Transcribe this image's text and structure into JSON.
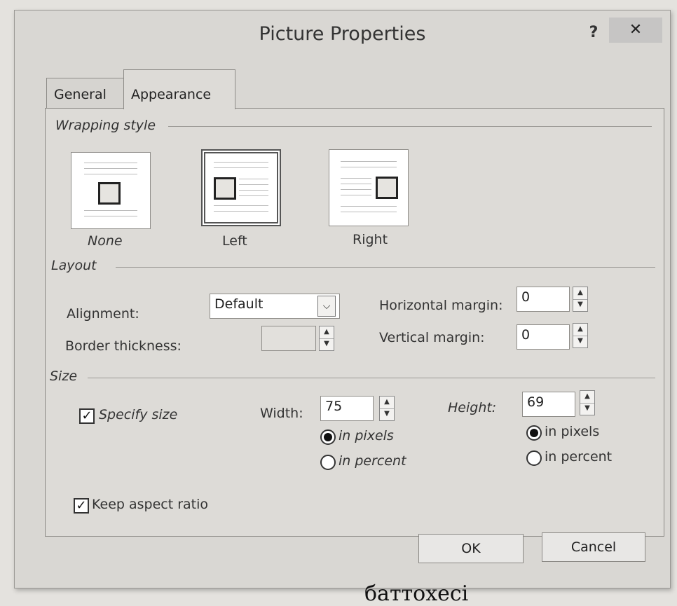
{
  "dialog": {
    "title": "Picture Properties",
    "help_label": "?",
    "close_label": "✕"
  },
  "tabs": [
    {
      "label": "General",
      "active": false
    },
    {
      "label": "Appearance",
      "active": true
    }
  ],
  "wrapping": {
    "group_label": "Wrapping style",
    "options": [
      {
        "label": "None",
        "selected": false
      },
      {
        "label": "Left",
        "selected": true
      },
      {
        "label": "Right",
        "selected": false
      }
    ]
  },
  "layout": {
    "group_label": "Layout",
    "alignment_label": "Alignment:",
    "alignment_value": "Default",
    "border_label": "Border thickness:",
    "border_value": "",
    "hmargin_label": "Horizontal margin:",
    "hmargin_value": "0",
    "vmargin_label": "Vertical margin:",
    "vmargin_value": "0"
  },
  "size": {
    "group_label": "Size",
    "specify_label": "Specify size",
    "specify_checked": true,
    "width_label": "Width:",
    "width_value": "75",
    "height_label": "Height:",
    "height_value": "69",
    "in_pixels": "in pixels",
    "in_percent": "in percent",
    "width_unit": "pixels",
    "height_unit": "pixels",
    "keep_aspect_label": "Keep aspect ratio",
    "keep_aspect_checked": true
  },
  "buttons": {
    "ok": "OK",
    "cancel": "Cancel"
  },
  "caption": "баттохесі"
}
